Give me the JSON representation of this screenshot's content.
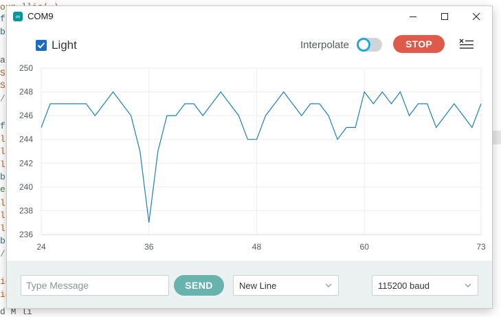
{
  "background": {
    "lines": [
      {
        "text": "oun     llis( )",
        "color": "#8a6a1a"
      },
      {
        "text": "f(",
        "color": "#2b6d8c"
      },
      {
        "text": "b",
        "color": "#2b6d8c"
      },
      {
        "text": "a",
        "color": "#555555"
      },
      {
        "text": "S",
        "color": "#c05a1a"
      },
      {
        "text": "S",
        "color": "#c05a1a"
      },
      {
        "text": "/",
        "color": "#888888"
      },
      {
        "text": "f(",
        "color": "#2b6d8c"
      },
      {
        "text": "l",
        "color": "#c05a1a"
      },
      {
        "text": "l",
        "color": "#c05a1a"
      },
      {
        "text": "l",
        "color": "#c05a1a"
      },
      {
        "text": "b",
        "color": "#2b6d8c"
      },
      {
        "text": "e",
        "color": "#3a7d2a"
      },
      {
        "text": "l",
        "color": "#c05a1a"
      },
      {
        "text": "l",
        "color": "#c05a1a"
      },
      {
        "text": "l",
        "color": "#c05a1a"
      },
      {
        "text": "b",
        "color": "#2b6d8c"
      },
      {
        "text": "/",
        "color": "#888888"
      },
      {
        "text": "ig",
        "color": "#c05a1a"
      },
      {
        "text": "ig",
        "color": "#c05a1a"
      },
      {
        "text": "d M  li",
        "color": "#555555"
      }
    ]
  },
  "window": {
    "title": "COM9",
    "app_icon": "infinity-icon"
  },
  "toolbar": {
    "series_checkbox": {
      "label": "Light",
      "checked": true,
      "color": "#1a6cbf"
    },
    "interpolate_label": "Interpolate",
    "interpolate_on": false,
    "stop_label": "STOP",
    "clear_icon": "clear-list-icon"
  },
  "chart_data": {
    "type": "line",
    "x_ticks": [
      24,
      36,
      48,
      60,
      73
    ],
    "y_ticks": [
      236,
      238,
      240,
      242,
      244,
      246,
      248,
      250
    ],
    "xlim": [
      24,
      73
    ],
    "ylim": [
      236,
      250
    ],
    "grid": true,
    "series": [
      {
        "name": "Light",
        "color": "#1a7fba",
        "x": [
          24,
          25,
          26,
          27,
          28,
          29,
          30,
          31,
          32,
          33,
          34,
          35,
          36,
          37,
          38,
          39,
          40,
          41,
          42,
          43,
          44,
          45,
          46,
          47,
          48,
          49,
          50,
          51,
          52,
          53,
          54,
          55,
          56,
          57,
          58,
          59,
          60,
          61,
          62,
          63,
          64,
          65,
          66,
          67,
          68,
          69,
          70,
          71,
          72,
          73
        ],
        "values": [
          245,
          247,
          247,
          247,
          247,
          247,
          246,
          247,
          248,
          247,
          246,
          243,
          237,
          243,
          246,
          246,
          247,
          247,
          246,
          247,
          248,
          247,
          246,
          244,
          244,
          246,
          247,
          248,
          247,
          246,
          247,
          247,
          246,
          244,
          245,
          245,
          248,
          247,
          248,
          247,
          248,
          246,
          247,
          247,
          245,
          246,
          247,
          246,
          245,
          247
        ]
      }
    ]
  },
  "bottom": {
    "message_placeholder": "Type Message",
    "message_value": "",
    "send_label": "SEND",
    "line_ending": "New Line",
    "baud": "115200 baud"
  }
}
